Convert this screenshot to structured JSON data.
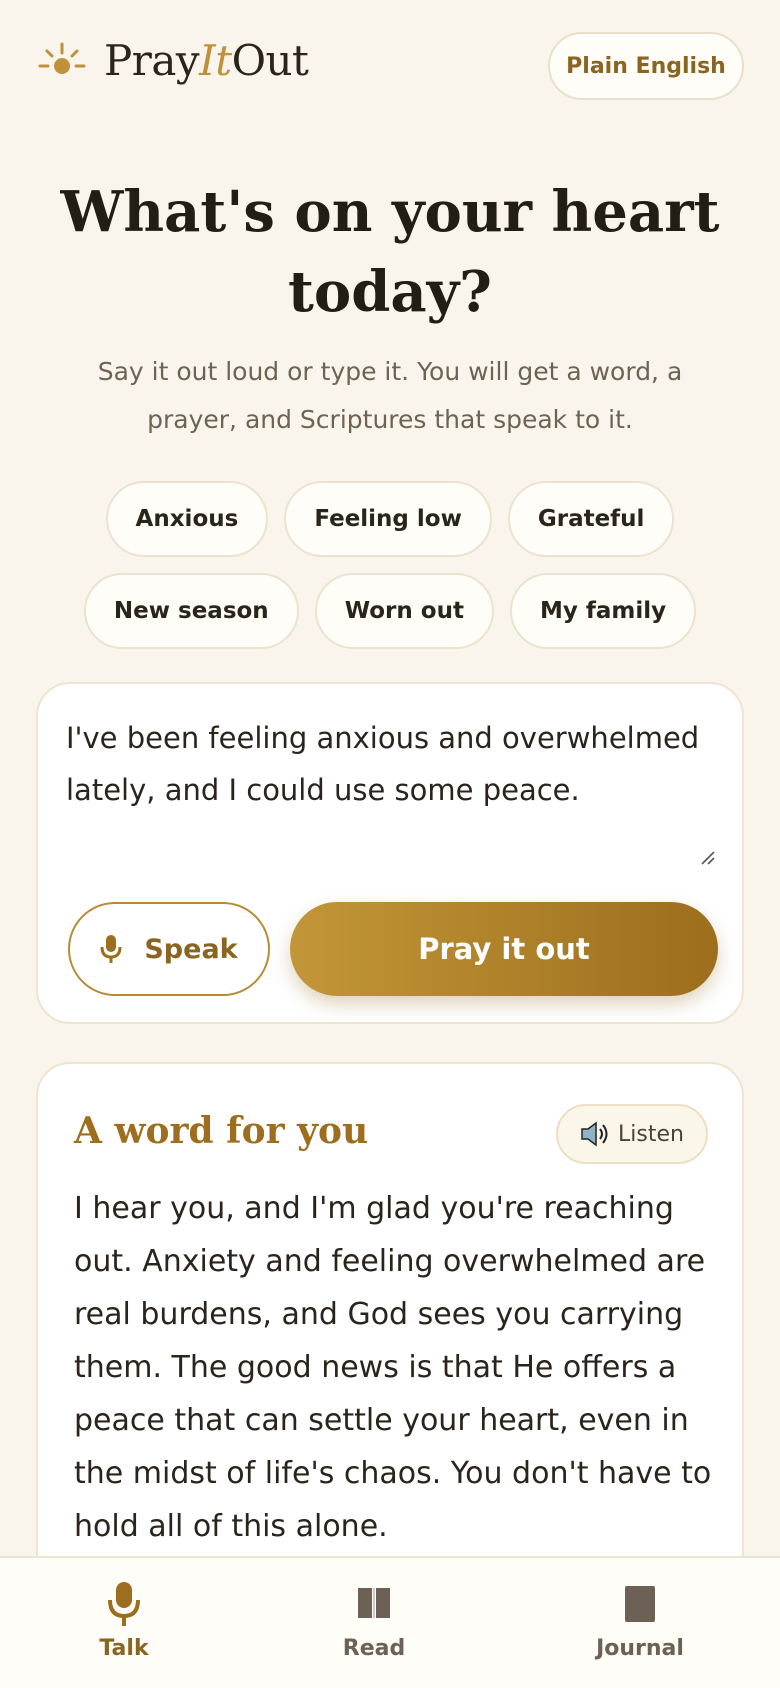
{
  "app": {
    "logo_prefix": "Pray",
    "logo_italic": "It",
    "logo_suffix": "Out",
    "language_button": "Plain English"
  },
  "hero": {
    "title": "What's on your heart today?",
    "subtitle": "Say it out loud or type it. You will get a word, a prayer, and Scriptures that speak to it."
  },
  "chips": [
    [
      "Anxious",
      "Feeling low",
      "Grateful"
    ],
    [
      "New season",
      "Worn out",
      "My family"
    ]
  ],
  "input": {
    "value": "I've been feeling anxious and overwhelmed lately, and I could use some peace.",
    "speak_label": "Speak",
    "submit_label": "Pray it out"
  },
  "word_card": {
    "title": "A word for you",
    "listen_label": "Listen",
    "body": "I hear you, and I'm glad you're reaching out. Anxiety and feeling overwhelmed are real burdens, and God sees you carrying them. The good news is that He offers a peace that can settle your heart, even in the midst of life's chaos. You don't have to hold all of this alone."
  },
  "nav": {
    "talk": "Talk",
    "read": "Read",
    "journal": "Journal"
  },
  "colors": {
    "background": "#f9f5ec",
    "accent": "#b88a35",
    "accent_dark": "#8a6420",
    "text": "#2a241b"
  },
  "icons": {
    "logo": "sun-icon",
    "speak": "microphone-icon",
    "listen": "speaker-icon",
    "nav_talk": "microphone-icon",
    "nav_read": "book-icon",
    "nav_journal": "journal-icon"
  }
}
